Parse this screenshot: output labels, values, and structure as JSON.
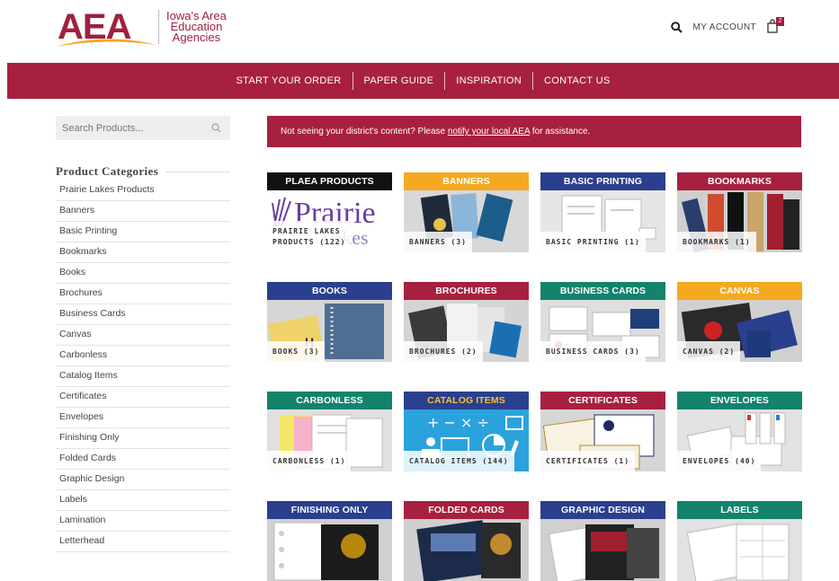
{
  "header": {
    "logo_letters": "AEA",
    "logo_text_lines": [
      "Iowa's Area",
      "Education",
      "Agencies"
    ],
    "account_label": "MY ACCOUNT",
    "cart_count": "2"
  },
  "nav": {
    "items": [
      "START YOUR ORDER",
      "PAPER GUIDE",
      "INSPIRATION",
      "CONTACT US"
    ]
  },
  "sidebar": {
    "search_placeholder": "Search Products...",
    "categories_heading": "Product Categories",
    "categories": [
      "Prairie Lakes Products",
      "Banners",
      "Basic Printing",
      "Bookmarks",
      "Books",
      "Brochures",
      "Business Cards",
      "Canvas",
      "Carbonless",
      "Catalog Items",
      "Certificates",
      "Envelopes",
      "Finishing Only",
      "Folded Cards",
      "Graphic Design",
      "Labels",
      "Lamination",
      "Letterhead"
    ]
  },
  "notice": {
    "before": "Not seeing your district's content? Please ",
    "link": "notify your local AEA",
    "after": " for assistance."
  },
  "tiles": [
    {
      "title": "PLAEA PRODUCTS",
      "label": "PRAIRIE LAKES\nPRODUCTS (122)",
      "color": "#111111",
      "image": "prairie-lakes-logo"
    },
    {
      "title": "BANNERS",
      "label": "BANNERS (3)",
      "color": "#f4a920",
      "image": "banners-photo"
    },
    {
      "title": "BASIC PRINTING",
      "label": "BASIC PRINTING (1)",
      "color": "#2b3f8f",
      "image": "basic-printing-photo"
    },
    {
      "title": "BOOKMARKS",
      "label": "BOOKMARKS (1)",
      "color": "#a8203f",
      "image": "bookmarks-photo"
    },
    {
      "title": "BOOKS",
      "label": "BOOKS (3)",
      "color": "#2b3f8f",
      "image": "books-photo"
    },
    {
      "title": "BROCHURES",
      "label": "BROCHURES (2)",
      "color": "#a8203f",
      "image": "brochures-photo"
    },
    {
      "title": "BUSINESS CARDS",
      "label": "BUSINESS CARDS (3)",
      "color": "#13836c",
      "image": "business-cards-photo"
    },
    {
      "title": "CANVAS",
      "label": "CANVAS (2)",
      "color": "#f4a920",
      "image": "canvas-photo"
    },
    {
      "title": "CARBONLESS",
      "label": "CARBONLESS (1)",
      "color": "#13836c",
      "image": "carbonless-photo"
    },
    {
      "title": "CATALOG ITEMS",
      "label": "CATALOG ITEMS (144)",
      "color": "#2b3f8f",
      "image": "catalog-items-graphic",
      "title_color": "#f4c430"
    },
    {
      "title": "CERTIFICATES",
      "label": "CERTIFICATES (1)",
      "color": "#a8203f",
      "image": "certificates-photo"
    },
    {
      "title": "ENVELOPES",
      "label": "ENVELOPES (40)",
      "color": "#13836c",
      "image": "envelopes-photo"
    },
    {
      "title": "FINISHING ONLY",
      "label": "",
      "color": "#2b3f8f",
      "image": "finishing-photo"
    },
    {
      "title": "FOLDED CARDS",
      "label": "",
      "color": "#a8203f",
      "image": "folded-cards-photo"
    },
    {
      "title": "GRAPHIC DESIGN",
      "label": "",
      "color": "#2b3f8f",
      "image": "graphic-design-photo"
    },
    {
      "title": "LABELS",
      "label": "",
      "color": "#13836c",
      "image": "labels-photo"
    }
  ]
}
